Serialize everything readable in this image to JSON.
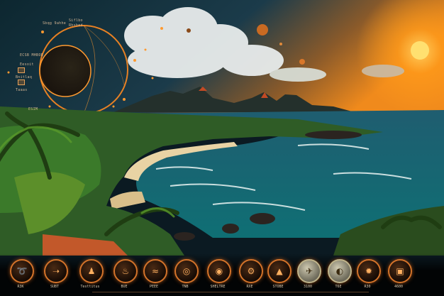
{
  "hud": {
    "labels": [
      "Sbqg 9ahhe",
      "Siflbo",
      "Rhsbed",
      "ECSB MHBOE",
      "Eesoit",
      "Bnitlaq",
      "Taaas",
      "ESIM"
    ]
  },
  "dock": {
    "buttons": [
      {
        "icon": "swirl-icon",
        "glyph": "➰",
        "caption": "R3K"
      },
      {
        "icon": "arrow-icon",
        "glyph": "➝",
        "caption": "SUBT"
      },
      {
        "icon": "figure-icon",
        "glyph": "♟",
        "caption": "Testtitus"
      },
      {
        "icon": "flame-icon",
        "glyph": "♨",
        "caption": "BUE"
      },
      {
        "icon": "wave-icon",
        "glyph": "≈",
        "caption": "PEEE"
      },
      {
        "icon": "rings-icon",
        "glyph": "◎",
        "caption": "TNB"
      },
      {
        "icon": "target-icon",
        "glyph": "◉",
        "caption": "SHELTRE"
      },
      {
        "icon": "gear-icon",
        "glyph": "⚙",
        "caption": "RXE"
      },
      {
        "icon": "peak-icon",
        "glyph": "▲",
        "caption": "STOBE"
      },
      {
        "icon": "plane-icon",
        "glyph": "✈",
        "caption": "3100"
      },
      {
        "icon": "globe-icon",
        "glyph": "◐",
        "caption": "T6E"
      },
      {
        "icon": "sun-icon",
        "glyph": "✹",
        "caption": "R30"
      },
      {
        "icon": "lock-icon",
        "glyph": "▣",
        "caption": "4600"
      }
    ]
  }
}
